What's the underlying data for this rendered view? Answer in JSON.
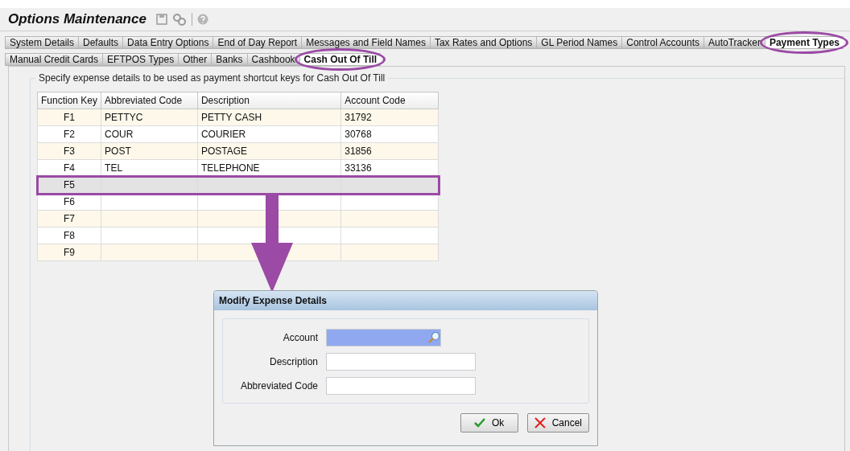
{
  "window": {
    "title": "Options Maintenance"
  },
  "tabs": [
    {
      "label": "System Details",
      "selected": false,
      "circled": false
    },
    {
      "label": "Defaults",
      "selected": false,
      "circled": false
    },
    {
      "label": "Data Entry Options",
      "selected": false,
      "circled": false
    },
    {
      "label": "End of Day Report",
      "selected": false,
      "circled": false
    },
    {
      "label": "Messages and Field Names",
      "selected": false,
      "circled": false
    },
    {
      "label": "Tax Rates and Options",
      "selected": false,
      "circled": false
    },
    {
      "label": "GL Period Names",
      "selected": false,
      "circled": false
    },
    {
      "label": "Control Accounts",
      "selected": false,
      "circled": false
    },
    {
      "label": "AutoTracker",
      "selected": false,
      "circled": false
    },
    {
      "label": "Payment Types",
      "selected": true,
      "circled": true
    }
  ],
  "subtabs": [
    {
      "label": "Manual Credit Cards",
      "selected": false,
      "circled": false
    },
    {
      "label": "EFTPOS Types",
      "selected": false,
      "circled": false
    },
    {
      "label": "Other",
      "selected": false,
      "circled": false
    },
    {
      "label": "Banks",
      "selected": false,
      "circled": false
    },
    {
      "label": "Cashbook",
      "selected": false,
      "circled": false
    },
    {
      "label": "Cash Out Of Till",
      "selected": true,
      "circled": true
    }
  ],
  "group": {
    "legend": "Specify expense details to be used as payment shortcut keys for Cash Out Of Till"
  },
  "table": {
    "columns": [
      "Function Key",
      "Abbreviated Code",
      "Description",
      "Account Code"
    ],
    "rows": [
      {
        "cells": [
          "F1",
          "PETTYC",
          "PETTY CASH",
          "31792"
        ],
        "selected": false,
        "boxed": false
      },
      {
        "cells": [
          "F2",
          "COUR",
          "COURIER",
          "30768"
        ],
        "selected": false,
        "boxed": false
      },
      {
        "cells": [
          "F3",
          "POST",
          "POSTAGE",
          "31856"
        ],
        "selected": false,
        "boxed": false
      },
      {
        "cells": [
          "F4",
          "TEL",
          "TELEPHONE",
          "33136"
        ],
        "selected": false,
        "boxed": false
      },
      {
        "cells": [
          "F5",
          "",
          "",
          ""
        ],
        "selected": true,
        "boxed": true
      },
      {
        "cells": [
          "F6",
          "",
          "",
          ""
        ],
        "selected": false,
        "boxed": false
      },
      {
        "cells": [
          "F7",
          "",
          "",
          ""
        ],
        "selected": false,
        "boxed": false
      },
      {
        "cells": [
          "F8",
          "",
          "",
          ""
        ],
        "selected": false,
        "boxed": false
      },
      {
        "cells": [
          "F9",
          "",
          "",
          ""
        ],
        "selected": false,
        "boxed": false
      }
    ]
  },
  "dialog": {
    "title": "Modify Expense Details",
    "fields": [
      {
        "label": "Account",
        "kind": "lookup",
        "focused": true
      },
      {
        "label": "Description",
        "kind": "text",
        "focused": false
      },
      {
        "label": "Abbreviated Code",
        "kind": "text",
        "focused": false
      }
    ],
    "buttons": [
      {
        "label": "Ok",
        "kind": "ok"
      },
      {
        "label": "Cancel",
        "kind": "cancel"
      }
    ]
  }
}
